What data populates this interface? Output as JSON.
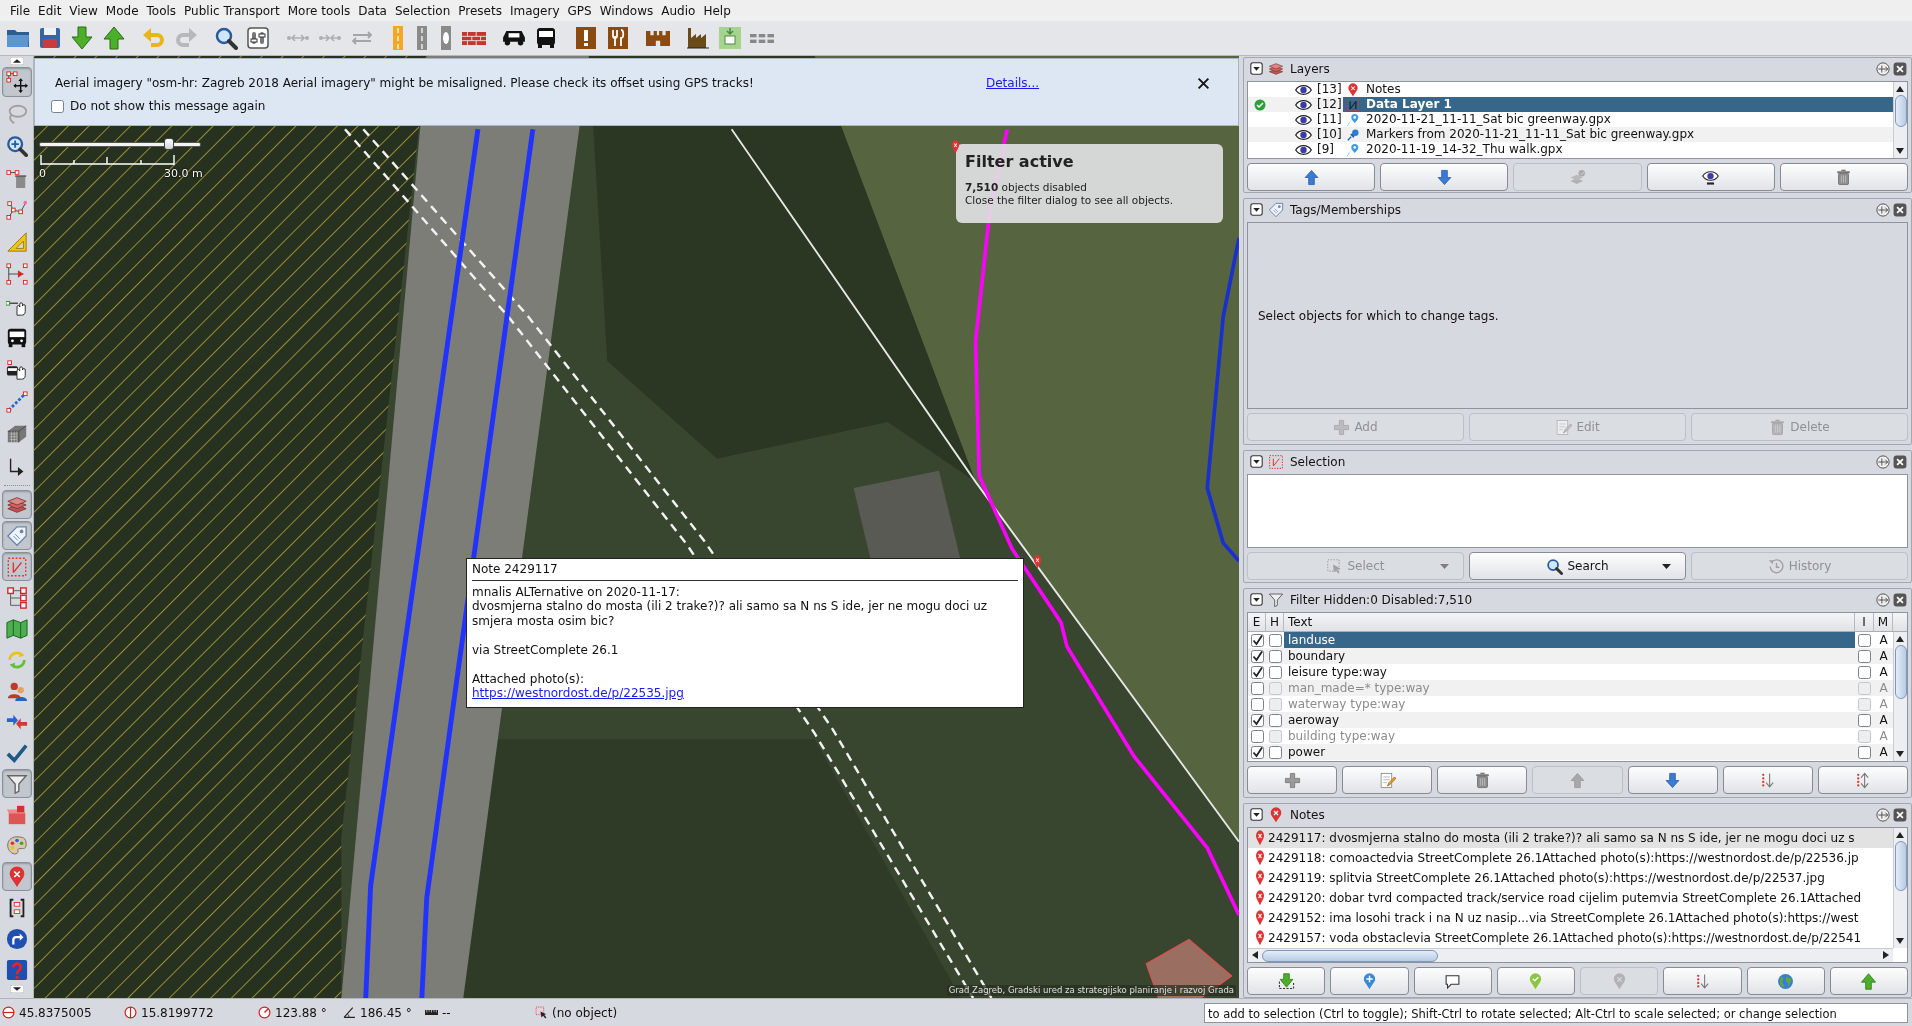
{
  "menu": [
    "File",
    "Edit",
    "View",
    "Mode",
    "Tools",
    "Public Transport",
    "More tools",
    "Data",
    "Selection",
    "Presets",
    "Imagery",
    "GPS",
    "Windows",
    "Audio",
    "Help"
  ],
  "toolbar": [
    [
      {
        "kind": "open",
        "disabled": false
      },
      {
        "kind": "save",
        "disabled": false
      },
      {
        "kind": "download",
        "disabled": false
      },
      {
        "kind": "upload",
        "disabled": false
      }
    ],
    [
      {
        "kind": "undo",
        "disabled": false
      },
      {
        "kind": "redo",
        "disabled": true
      }
    ],
    [
      {
        "kind": "zoom",
        "disabled": false
      },
      {
        "kind": "preferences",
        "disabled": false
      }
    ],
    [
      {
        "kind": "split",
        "disabled": true
      },
      {
        "kind": "combine",
        "disabled": true
      },
      {
        "kind": "reverse",
        "disabled": true
      }
    ],
    [
      {
        "kind": "highway",
        "disabled": false
      },
      {
        "kind": "street",
        "disabled": false
      },
      {
        "kind": "junction",
        "disabled": false
      },
      {
        "kind": "barrier",
        "disabled": false
      }
    ],
    [
      {
        "kind": "car",
        "disabled": false
      },
      {
        "kind": "bus",
        "disabled": false
      }
    ],
    [
      {
        "kind": "facility",
        "disabled": false
      },
      {
        "kind": "food",
        "disabled": false
      }
    ],
    [
      {
        "kind": "historic",
        "disabled": false
      }
    ],
    [
      {
        "kind": "industry",
        "disabled": false
      },
      {
        "kind": "package",
        "disabled": false
      },
      {
        "kind": "more",
        "disabled": false
      }
    ]
  ],
  "sidebar": {
    "modes": [
      {
        "kind": "select",
        "selected": true
      },
      {
        "kind": "lasso",
        "selected": false
      },
      {
        "kind": "zoom",
        "selected": false
      },
      {
        "kind": "delete",
        "selected": false
      },
      {
        "kind": "draw",
        "selected": false
      },
      {
        "kind": "measure",
        "selected": false
      },
      {
        "kind": "improve",
        "selected": false
      },
      {
        "kind": "parallel",
        "selected": false
      },
      {
        "kind": "bus",
        "selected": false
      },
      {
        "kind": "platform",
        "selected": false
      },
      {
        "kind": "line",
        "selected": false
      },
      {
        "kind": "building",
        "selected": false
      },
      {
        "kind": "more",
        "selected": false
      }
    ],
    "dialogs": [
      {
        "kind": "layers",
        "on": true
      },
      {
        "kind": "tags",
        "on": true
      },
      {
        "kind": "selection",
        "on": true
      },
      {
        "kind": "relations",
        "on": false
      },
      {
        "kind": "minimap",
        "on": false
      },
      {
        "kind": "changesets",
        "on": false
      },
      {
        "kind": "authors",
        "on": false
      },
      {
        "kind": "conflicts",
        "on": false
      },
      {
        "kind": "validation",
        "on": false
      },
      {
        "kind": "filter",
        "on": true
      },
      {
        "kind": "boxes",
        "on": false
      },
      {
        "kind": "palette",
        "on": false
      },
      {
        "kind": "notes",
        "on": true
      },
      {
        "kind": "commands",
        "on": false
      },
      {
        "kind": "history",
        "on": false
      },
      {
        "kind": "help",
        "on": false
      }
    ]
  },
  "notification": {
    "message": "Aerial imagery \"osm-hr: Zagreb 2018 Aerial imagery\" might be misaligned. Please check its offset using GPS tracks!",
    "link": "Details...",
    "checkbox": {
      "label": "Do not show this message again",
      "checked": false
    }
  },
  "map": {
    "zoom_slider": {
      "level": 0.8
    },
    "scale": {
      "start": "0",
      "end": "30.0 m"
    },
    "filter_banner": {
      "title": "Filter active",
      "count": "**7,510** objects disabled",
      "hint": "Close the filter dialog to see all objects."
    },
    "note_popup": {
      "title": "Note 2429117",
      "author": "mnalis ALTernative on 2020-11-17:",
      "comment": "dvosmjerna stalno do mosta (ili 2 trake?)? ali samo sa N ns S ide, jer ne mogu doci uz smjera mosta osim bic?",
      "via": "via StreetComplete 26.1",
      "attachments": "Attached photo(s):",
      "link": "https://westnordost.de/p/22535.jpg"
    },
    "attribution": "Grad Zagreb, Gradski ured za strategijsko planiranje i razvoj Grada"
  },
  "layers": {
    "title": "Layers",
    "rows": [
      {
        "index": "[13]",
        "name": "Notes",
        "kind": "notes",
        "visible": true,
        "active": false,
        "selected": false
      },
      {
        "index": "[12]",
        "name": "Data Layer 1",
        "kind": "data",
        "visible": true,
        "active": true,
        "selected": true
      },
      {
        "index": "[11]",
        "name": "2020-11-21_11-11_Sat bic greenway.gpx",
        "kind": "gpx",
        "visible": true,
        "active": false,
        "selected": false
      },
      {
        "index": "[10]",
        "name": "Markers from 2020-11-21_11-11_Sat bic greenway.gpx",
        "kind": "markers",
        "visible": true,
        "active": false,
        "selected": false
      },
      {
        "index": "[9]",
        "name": "2020-11-19_14-32_Thu walk.gpx",
        "kind": "gpx",
        "visible": true,
        "active": false,
        "selected": false
      }
    ],
    "buttons": [
      {
        "kind": "up",
        "disabled": false
      },
      {
        "kind": "down",
        "disabled": false
      },
      {
        "kind": "merge",
        "disabled": true
      },
      {
        "kind": "visibility",
        "disabled": false
      },
      {
        "kind": "delete",
        "disabled": false
      }
    ]
  },
  "tags": {
    "title": "Tags/Memberships",
    "message": "Select objects for which to change tags.",
    "buttons": [
      {
        "kind": "add",
        "label": "Add",
        "disabled": true
      },
      {
        "kind": "edit",
        "label": "Edit",
        "disabled": true
      },
      {
        "kind": "delete",
        "label": "Delete",
        "disabled": true
      }
    ]
  },
  "selection": {
    "title": "Selection",
    "buttons": [
      {
        "kind": "select",
        "label": "Select",
        "disabled": true,
        "dropdown": true
      },
      {
        "kind": "search",
        "label": "Search",
        "disabled": false,
        "dropdown": true
      },
      {
        "kind": "history",
        "label": "History",
        "disabled": true,
        "dropdown": false
      }
    ]
  },
  "filter": {
    "title": "Filter Hidden:0 Disabled:7,510",
    "columns": [
      "E",
      "H",
      "Text",
      "I",
      "M"
    ],
    "rows": [
      {
        "text": "landuse",
        "enabled": true,
        "hiding": false,
        "inverted": false,
        "mode": "A",
        "selected": true
      },
      {
        "text": "boundary",
        "enabled": true,
        "hiding": false,
        "inverted": false,
        "mode": "A",
        "selected": false
      },
      {
        "text": "leisure type:way",
        "enabled": true,
        "hiding": false,
        "inverted": false,
        "mode": "A",
        "selected": false
      },
      {
        "text": "man_made=* type:way",
        "enabled": false,
        "hiding": false,
        "inverted": false,
        "mode": "A",
        "selected": false
      },
      {
        "text": "waterway type:way",
        "enabled": false,
        "hiding": false,
        "inverted": false,
        "mode": "A",
        "selected": false
      },
      {
        "text": "aeroway",
        "enabled": true,
        "hiding": false,
        "inverted": false,
        "mode": "A",
        "selected": false
      },
      {
        "text": "building type:way",
        "enabled": false,
        "hiding": false,
        "inverted": false,
        "mode": "A",
        "selected": false
      },
      {
        "text": "power",
        "enabled": true,
        "hiding": false,
        "inverted": false,
        "mode": "A",
        "selected": false
      }
    ],
    "buttons": [
      {
        "kind": "add",
        "disabled": false
      },
      {
        "kind": "edit",
        "disabled": false
      },
      {
        "kind": "delete",
        "disabled": false
      },
      {
        "kind": "up",
        "disabled": true
      },
      {
        "kind": "down",
        "disabled": false
      },
      {
        "kind": "sortdown",
        "disabled": false
      },
      {
        "kind": "sortupdown",
        "disabled": false
      }
    ]
  },
  "notes": {
    "title": "Notes",
    "rows": [
      {
        "text": "2429117: dvosmjerna stalno do mosta (ili 2 trake?)? ali samo sa N ns S ide, jer ne mogu doci uz s",
        "selected": true
      },
      {
        "text": "2429118: comoactedvia StreetComplete 26.1Attached photo(s):https://westnordost.de/p/22536.jp",
        "selected": false
      },
      {
        "text": "2429119: splitvia StreetComplete 26.1Attached photo(s):https://westnordost.de/p/22537.jpg",
        "selected": false
      },
      {
        "text": "2429120: dobar tvrd compacted track/service road cijelim putemvia StreetComplete 26.1Attached",
        "selected": false
      },
      {
        "text": "2429152: ima losohi track i na N uz nasip...via StreetComplete 26.1Attached photo(s):https://west",
        "selected": false
      },
      {
        "text": "2429157: voda obstaclevia StreetComplete 26.1Attached photo(s):https://westnordost.de/p/22541",
        "selected": false
      }
    ],
    "buttons": [
      {
        "kind": "download",
        "disabled": false
      },
      {
        "kind": "newnote",
        "disabled": false
      },
      {
        "kind": "comment",
        "disabled": false
      },
      {
        "kind": "resolve",
        "disabled": false
      },
      {
        "kind": "reopen",
        "disabled": true
      },
      {
        "kind": "sortdown",
        "disabled": false
      },
      {
        "kind": "browser",
        "disabled": false
      },
      {
        "kind": "upload",
        "disabled": false
      }
    ]
  },
  "status_bar": {
    "latitude": "45.8375005",
    "longitude": "15.8199772",
    "heading": "123.88 °",
    "angle": "186.45 °",
    "distance": "--",
    "object": "(no object)",
    "help": "to add to selection (Ctrl to toggle); Shift-Ctrl to rotate selected; Alt-Ctrl to scale selected; or change selection"
  }
}
